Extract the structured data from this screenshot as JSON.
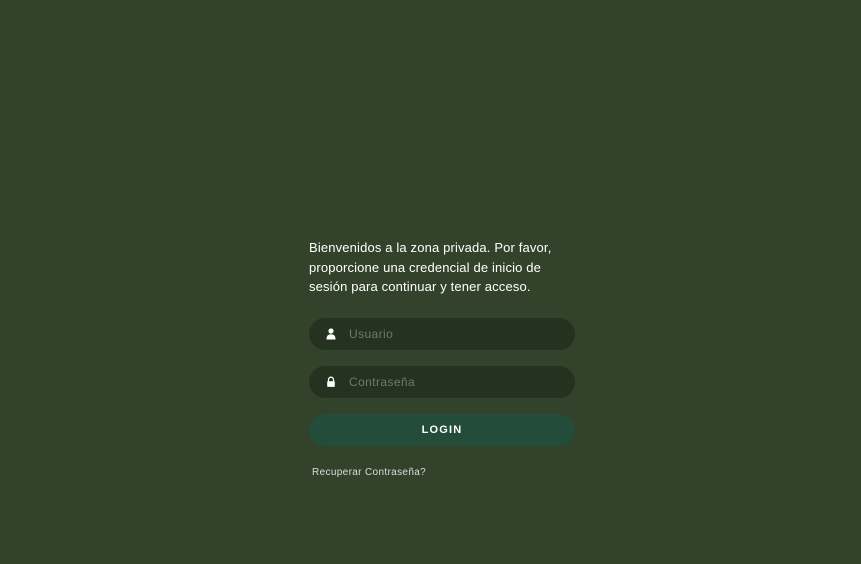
{
  "colors": {
    "background": "#33432b",
    "field_background": "#25321f",
    "button_background": "#234c3a",
    "text": "#ffffff"
  },
  "welcome": {
    "text": "Bienvenidos a la zona privada. Por favor, proporcione una credencial de inicio de sesión para continuar y tener acceso."
  },
  "form": {
    "username": {
      "placeholder": "Usuario",
      "value": "",
      "icon": "user-icon"
    },
    "password": {
      "placeholder": "Contraseña",
      "value": "",
      "icon": "lock-icon"
    },
    "login_label": "LOGIN",
    "recover_label": "Recuperar Contraseña?"
  }
}
